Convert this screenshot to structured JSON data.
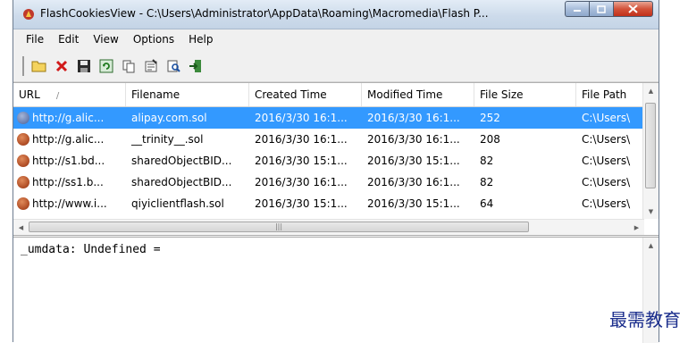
{
  "window": {
    "title": "FlashCookiesView  -  C:\\Users\\Administrator\\AppData\\Roaming\\Macromedia\\Flash P..."
  },
  "menu": [
    "File",
    "Edit",
    "View",
    "Options",
    "Help"
  ],
  "toolbar": [
    "folder-open-icon",
    "delete-icon",
    "save-icon",
    "refresh-icon",
    "copy-icon",
    "properties-icon",
    "find-icon",
    "exit-icon"
  ],
  "list": {
    "columns": [
      "URL",
      "Filename",
      "Created Time",
      "Modified Time",
      "File Size",
      "File Path"
    ],
    "sort_indicator": "/",
    "rows": [
      [
        "http://g.alic...",
        "alipay.com.sol",
        "2016/3/30 16:1...",
        "2016/3/30 16:1...",
        "252",
        "C:\\Users\\"
      ],
      [
        "http://g.alic...",
        "__trinity__.sol",
        "2016/3/30 16:1...",
        "2016/3/30 16:1...",
        "208",
        "C:\\Users\\"
      ],
      [
        "http://s1.bd...",
        "sharedObjectBID...",
        "2016/3/30 15:1...",
        "2016/3/30 15:1...",
        "82",
        "C:\\Users\\"
      ],
      [
        "http://ss1.b...",
        "sharedObjectBID...",
        "2016/3/30 16:1...",
        "2016/3/30 16:1...",
        "82",
        "C:\\Users\\"
      ],
      [
        "http://www.i...",
        "qiyiclientflash.sol",
        "2016/3/30 15:1...",
        "2016/3/30 15:1...",
        "64",
        "C:\\Users\\"
      ]
    ],
    "selected_row": 0
  },
  "details": {
    "text": "_umdata: Undefined ="
  },
  "watermark": "最需教育"
}
